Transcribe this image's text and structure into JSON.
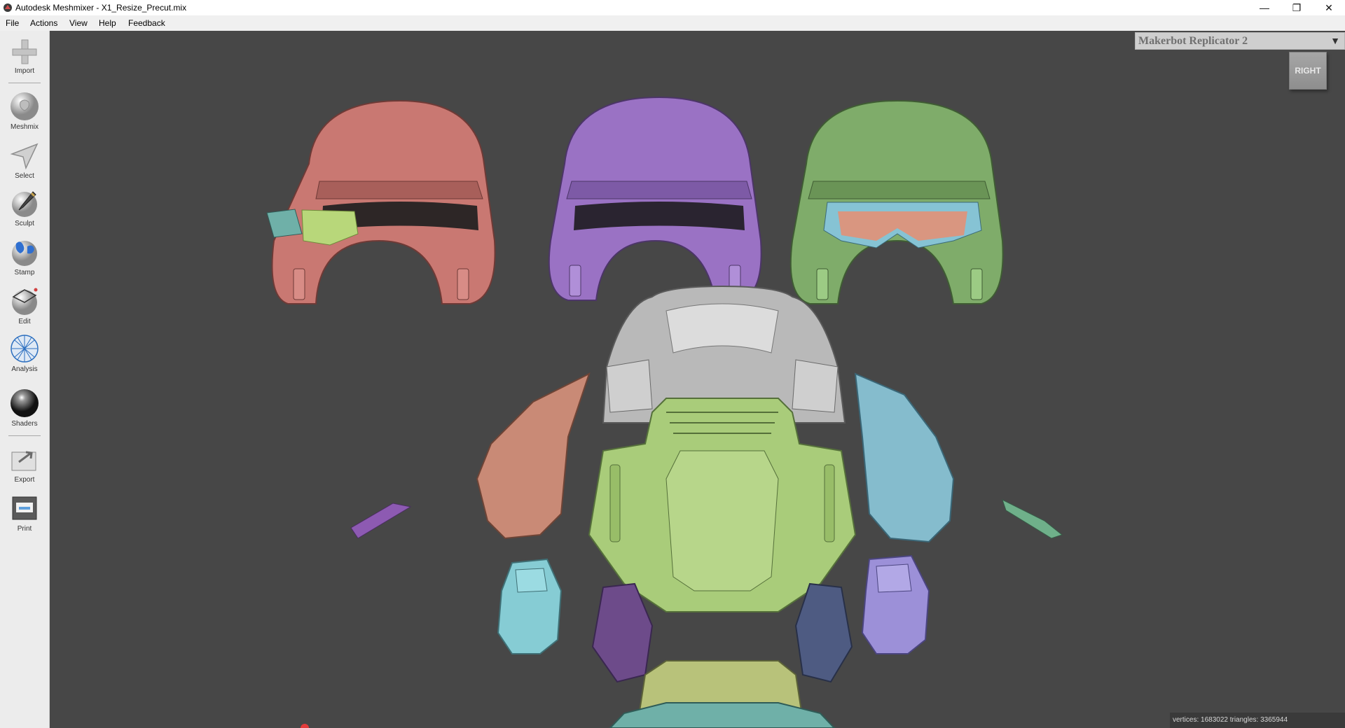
{
  "window": {
    "title": "Autodesk Meshmixer - X1_Resize_Precut.mix"
  },
  "menu": [
    "File",
    "Actions",
    "View",
    "Help",
    "Feedback"
  ],
  "tools": [
    {
      "name": "import",
      "label": "Import"
    },
    {
      "name": "meshmix",
      "label": "Meshmix"
    },
    {
      "name": "select",
      "label": "Select"
    },
    {
      "name": "sculpt",
      "label": "Sculpt"
    },
    {
      "name": "stamp",
      "label": "Stamp"
    },
    {
      "name": "edit",
      "label": "Edit"
    },
    {
      "name": "analysis",
      "label": "Analysis"
    },
    {
      "name": "shaders",
      "label": "Shaders"
    },
    {
      "name": "export",
      "label": "Export"
    },
    {
      "name": "print",
      "label": "Print"
    }
  ],
  "printer": {
    "name": "Makerbot Replicator 2"
  },
  "viewcube": {
    "face": "RIGHT"
  },
  "status": {
    "text": "vertices: 1683022 triangles: 3365944"
  },
  "colors": {
    "viewport": "#474747",
    "helmet_left": "#c97872",
    "helmet_center": "#9a72c4",
    "helmet_right": "#7fac6a",
    "chest_gray": "#b8b8b8",
    "chest_plate": "#a9cc7a",
    "shoulder_left": "#c98a76",
    "shoulder_right": "#85bccd",
    "teal": "#6fb0a8",
    "purple_piece": "#7d5a9a",
    "lavender": "#9c90d8",
    "cyan_piece": "#86ccd4",
    "navy_piece": "#4e5b82"
  }
}
